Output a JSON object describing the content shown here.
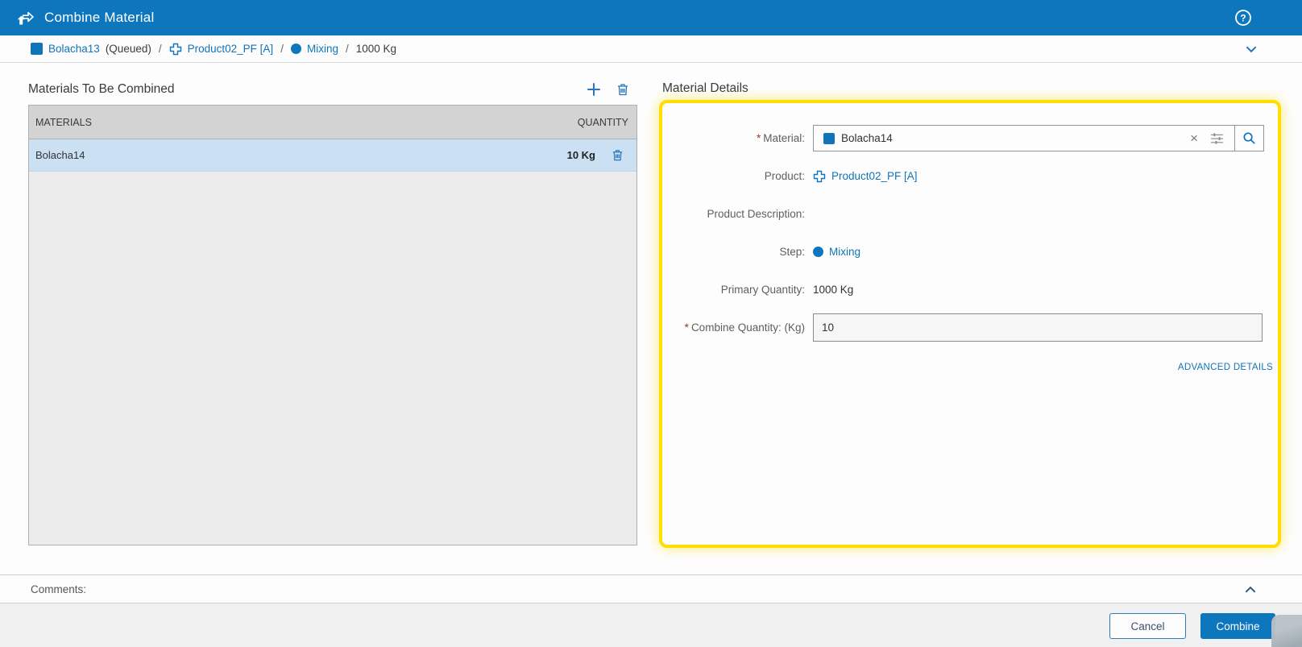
{
  "colors": {
    "accent": "#0d76bc",
    "link": "#1274b8",
    "yellow": "#ffde00",
    "rowsel": "#cbe1f3",
    "req": "#a6342e"
  },
  "icons": {
    "help_glyph": "?",
    "clear_glyph": "×"
  },
  "titlebar": {
    "title": "Combine Material"
  },
  "breadcrumb": {
    "separator": "/",
    "material_label": "Bolacha13",
    "status": "(Queued)",
    "product_label": "Product02_PF [A]",
    "step_label": "Mixing",
    "quantity": "1000 Kg"
  },
  "materials_panel": {
    "title": "Materials To Be Combined",
    "table": {
      "headers": [
        "MATERIALS",
        "QUANTITY"
      ],
      "rows": [
        {
          "material": "Bolacha14",
          "quantity": "10 Kg"
        }
      ]
    }
  },
  "details_panel": {
    "title": "Material Details",
    "fields": {
      "material": {
        "required": "*",
        "label": "Material:",
        "value": "Bolacha14"
      },
      "product": {
        "label": "Product:",
        "value": "Product02_PF [A]"
      },
      "product_description": {
        "label": "Product Description:",
        "value": ""
      },
      "step": {
        "label": "Step:",
        "value": "Mixing"
      },
      "primary_quantity": {
        "label": "Primary Quantity:",
        "value": "1000 Kg"
      },
      "combine_quantity": {
        "required": "*",
        "label": "Combine Quantity: (Kg)",
        "value": "10"
      }
    },
    "advanced_details_label": "ADVANCED DETAILS"
  },
  "comments": {
    "label": "Comments:"
  },
  "footer": {
    "cancel_label": "Cancel",
    "combine_label": "Combine"
  }
}
